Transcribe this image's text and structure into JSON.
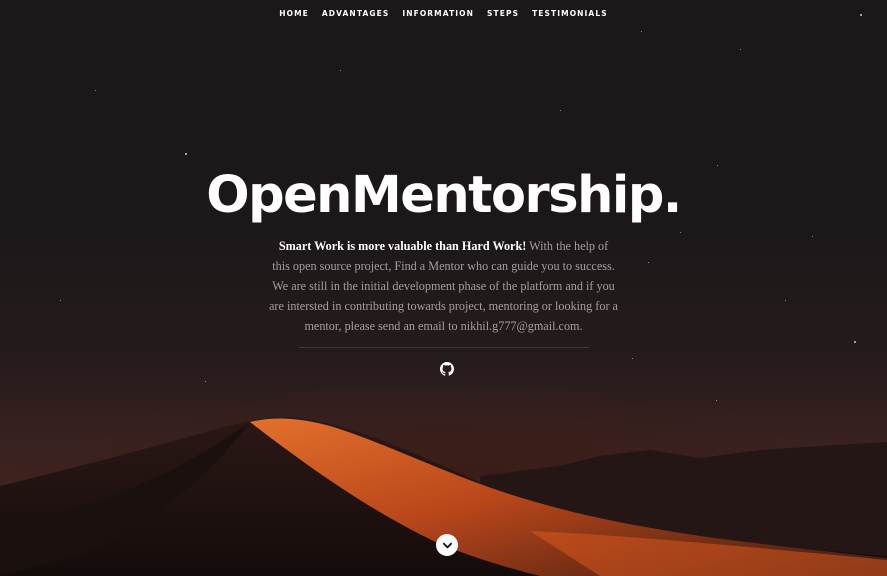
{
  "nav": {
    "items": [
      {
        "label": "HOME"
      },
      {
        "label": "ADVANTAGES"
      },
      {
        "label": "INFORMATION"
      },
      {
        "label": "STEPS"
      },
      {
        "label": "TESTIMONIALS"
      }
    ]
  },
  "hero": {
    "title": "OpenMentorship.",
    "tagline": "Smart Work is more valuable than Hard Work!",
    "description": " With the help of this open source project, Find a Mentor who can guide you to success. We are still in the initial development phase of the platform and if you are intersted in contributing towards project, mentoring or looking for a mentor, please send an email to nikhil.g777@gmail.com."
  },
  "icons": {
    "github": "github-icon",
    "scroll": "chevron-down-icon"
  },
  "colors": {
    "background": "#1a1718",
    "text_muted": "#a49e9f",
    "dune_glow": "#d9581f"
  }
}
